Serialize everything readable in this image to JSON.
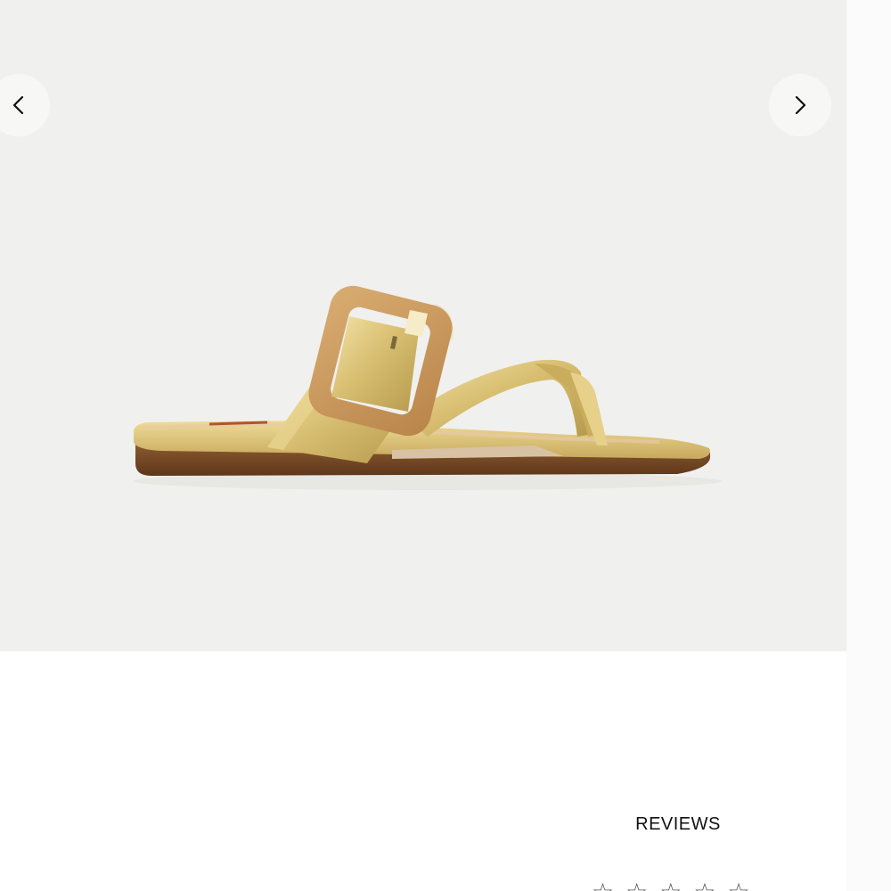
{
  "gallery": {
    "image_alt": "Gold metallic thong sandal with woven buckle strap",
    "prev_icon": "chevron-left-icon",
    "next_icon": "chevron-right-icon"
  },
  "reviews": {
    "heading": "REVIEWS",
    "star_icon": "star-icon"
  },
  "colors": {
    "gallery_bg": "#f0f0ee",
    "sandal_gold": "#d9c27a",
    "buckle_tan": "#c9965a",
    "sole_brown": "#7a4a24"
  }
}
